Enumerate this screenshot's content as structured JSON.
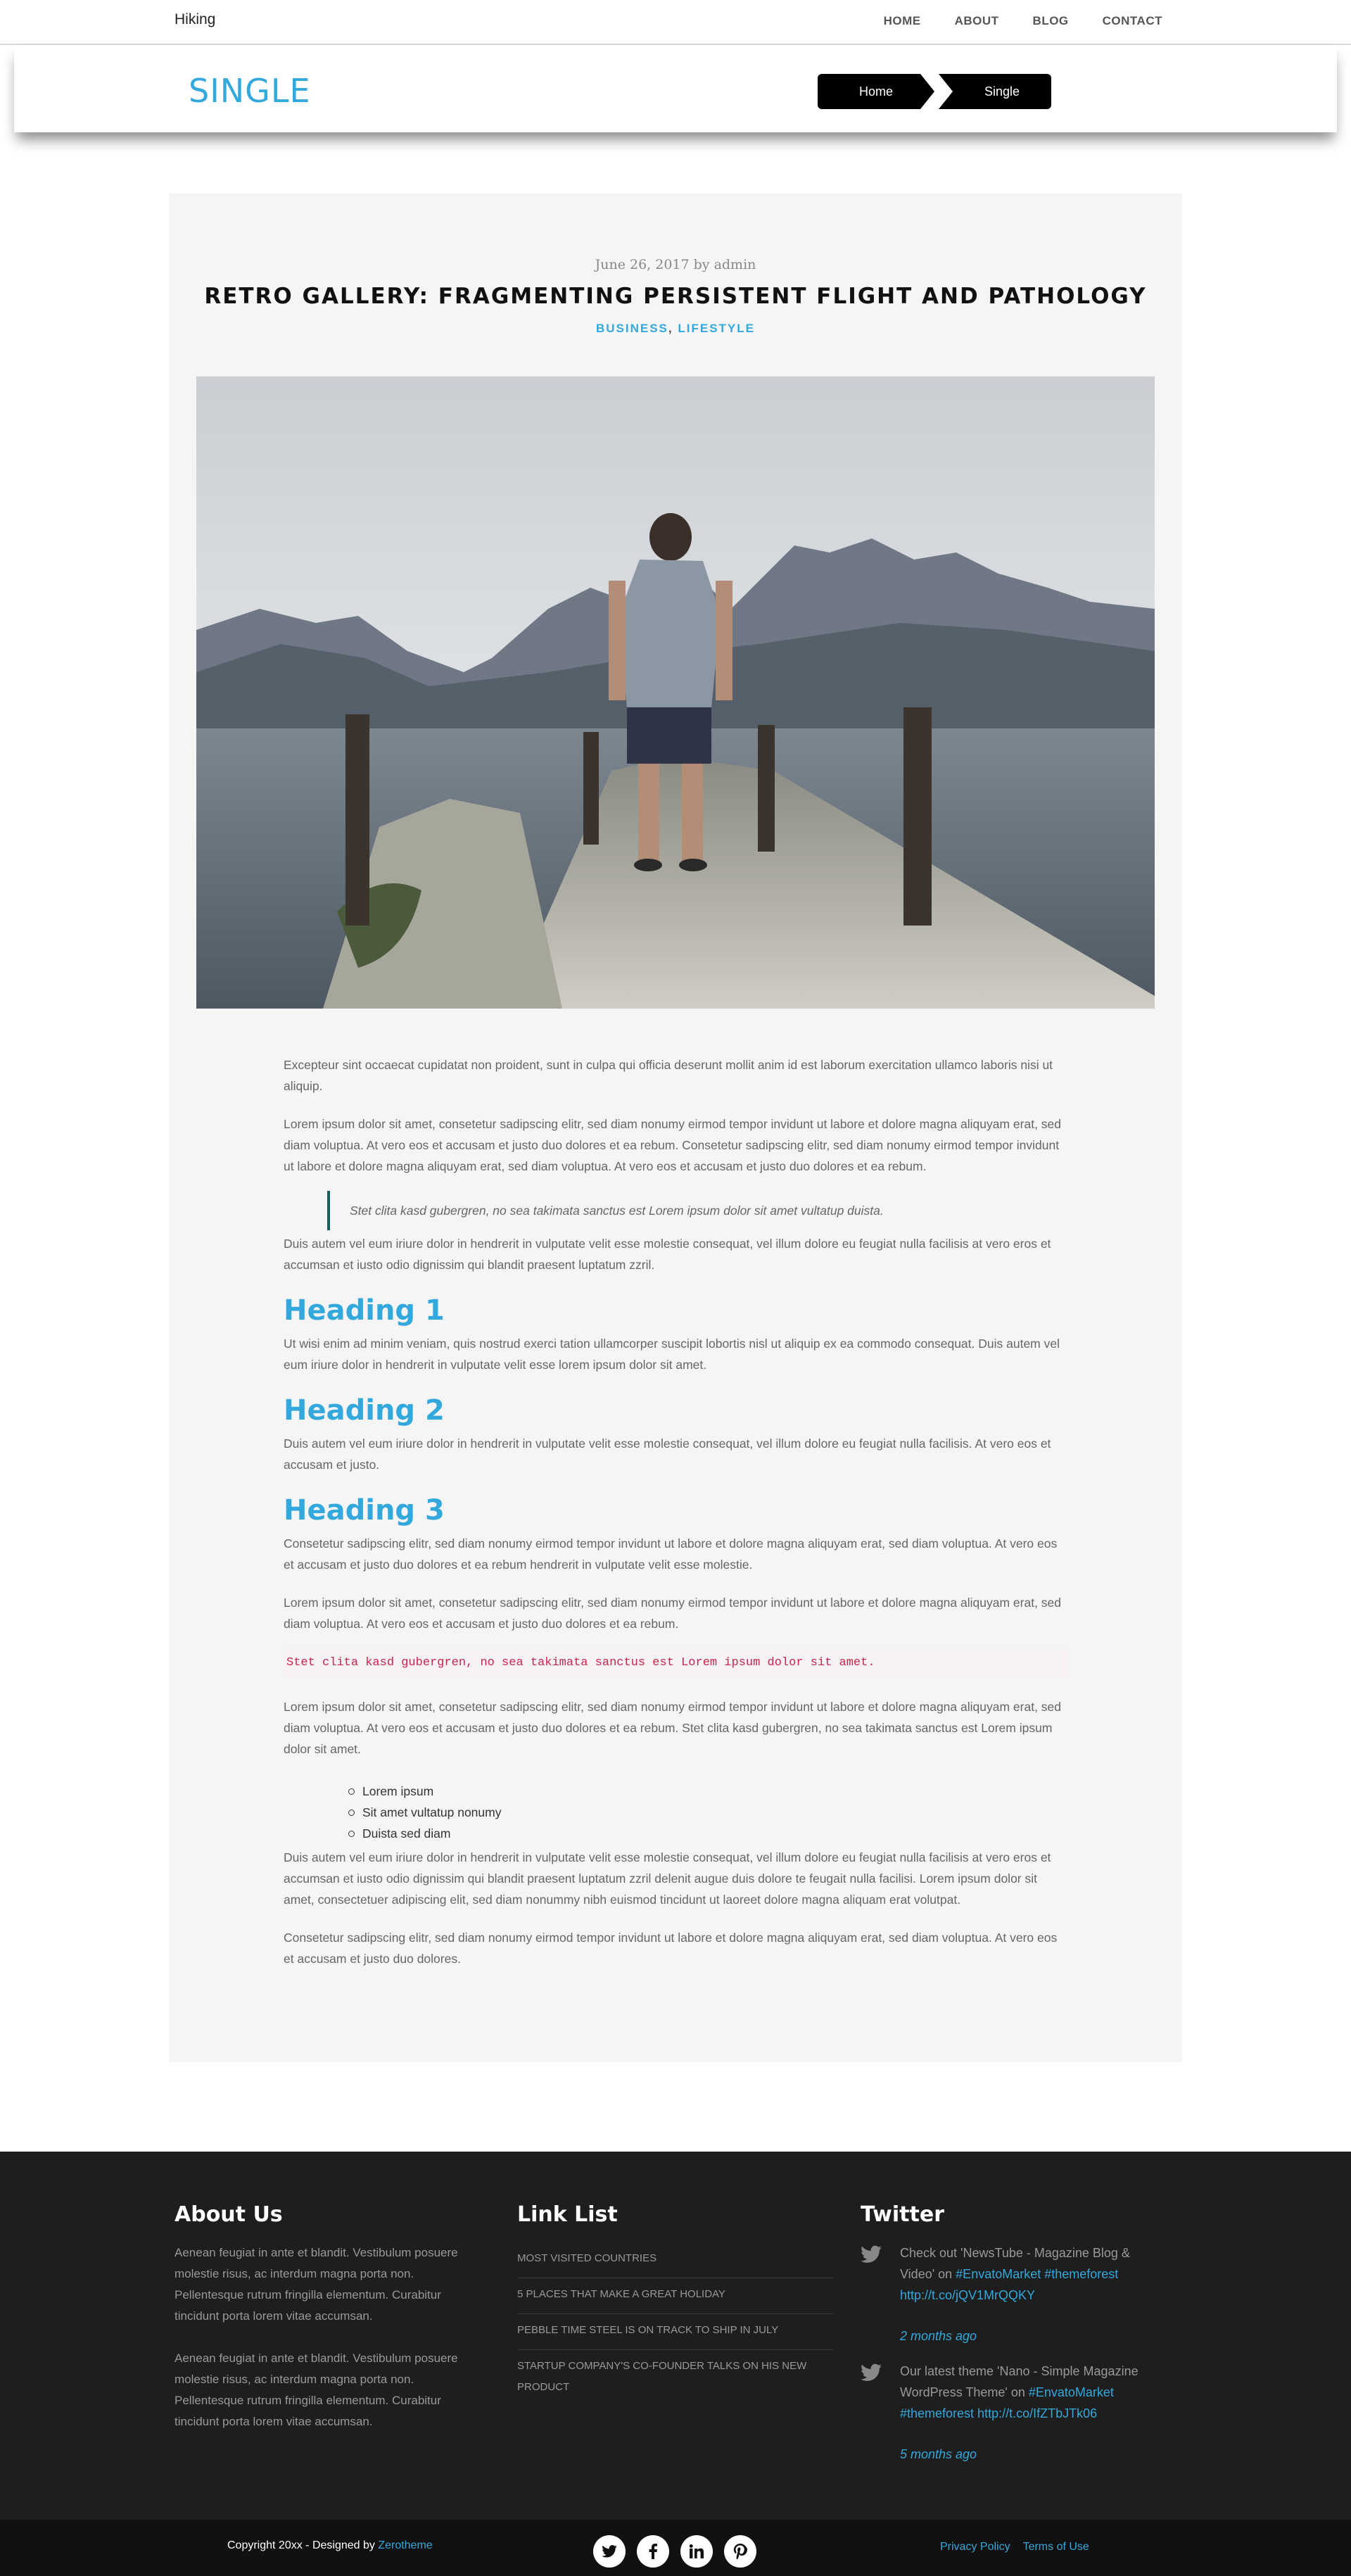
{
  "navbar": {
    "brand": "Hiking",
    "links": [
      "HOME",
      "ABOUT",
      "BLOG",
      "CONTACT"
    ]
  },
  "titlebar": {
    "title": "SINGLE",
    "breadcrumb": [
      "Home",
      "Single"
    ]
  },
  "post": {
    "meta": "June 26, 2017 by admin",
    "title": "RETRO GALLERY: FRAGMENTING PERSISTENT FLIGHT AND PATHOLOGY",
    "categories": [
      "BUSINESS",
      "LIFESTYLE"
    ],
    "category_separator": ",",
    "p1": "Excepteur sint occaecat cupidatat non proident, sunt in culpa qui officia deserunt mollit anim id est laborum exercitation ullamco laboris nisi ut aliquip.",
    "p2": "Lorem ipsum dolor sit amet, consetetur sadipscing elitr, sed diam nonumy eirmod tempor invidunt ut labore et dolore magna aliquyam erat, sed diam voluptua. At vero eos et accusam et justo duo dolores et ea rebum. Consetetur sadipscing elitr, sed diam nonumy eirmod tempor invidunt ut labore et dolore magna aliquyam erat, sed diam voluptua. At vero eos et accusam et justo duo dolores et ea rebum.",
    "quote": "Stet clita kasd gubergren, no sea takimata sanctus est Lorem ipsum dolor sit amet vultatup duista.",
    "p3": "Duis autem vel eum iriure dolor in hendrerit in vulputate velit esse molestie consequat, vel illum dolore eu feugiat nulla facilisis at vero eros et accumsan et iusto odio dignissim qui blandit praesent luptatum zzril.",
    "h1": "Heading 1",
    "p4": "Ut wisi enim ad minim veniam, quis nostrud exerci tation ullamcorper suscipit lobortis nisl ut aliquip ex ea commodo consequat. Duis autem vel eum iriure dolor in hendrerit in vulputate velit esse lorem ipsum dolor sit amet.",
    "h2": "Heading 2",
    "p5": "Duis autem vel eum iriure dolor in hendrerit in vulputate velit esse molestie consequat, vel illum dolore eu feugiat nulla facilisis. At vero eos et accusam et justo.",
    "h3": "Heading 3",
    "p6": "Consetetur sadipscing elitr, sed diam nonumy eirmod tempor invidunt ut labore et dolore magna aliquyam erat, sed diam voluptua. At vero eos et accusam et justo duo dolores et ea rebum hendrerit in vulputate velit esse molestie.",
    "p7": "Lorem ipsum dolor sit amet, consetetur sadipscing elitr, sed diam nonumy eirmod tempor invidunt ut labore et dolore magna aliquyam erat, sed diam voluptua. At vero eos et accusam et justo duo dolores et ea rebum.",
    "code": "Stet clita kasd gubergren, no sea takimata sanctus est Lorem ipsum dolor sit amet.",
    "p8": "Lorem ipsum dolor sit amet, consetetur sadipscing elitr, sed diam nonumy eirmod tempor invidunt ut labore et dolore magna aliquyam erat, sed diam voluptua. At vero eos et accusam et justo duo dolores et ea rebum. Stet clita kasd gubergren, no sea takimata sanctus est Lorem ipsum dolor sit amet.",
    "list": [
      "Lorem ipsum",
      "Sit amet vultatup nonumy",
      "Duista sed diam"
    ],
    "p9": "Duis autem vel eum iriure dolor in hendrerit in vulputate velit esse molestie consequat, vel illum dolore eu feugiat nulla facilisis at vero eros et accumsan et iusto odio dignissim qui blandit praesent luptatum zzril delenit augue duis dolore te feugait nulla facilisi. Lorem ipsum dolor sit amet, consectetuer adipiscing elit, sed diam nonummy nibh euismod tincidunt ut laoreet dolore magna aliquam erat volutpat.",
    "p10": "Consetetur sadipscing elitr, sed diam nonumy eirmod tempor invidunt ut labore et dolore magna aliquyam erat, sed diam voluptua. At vero eos et accusam et justo duo dolores."
  },
  "footer": {
    "about": {
      "heading": "About Us",
      "paragraphs": [
        "Aenean feugiat in ante et blandit. Vestibulum posuere molestie risus, ac interdum magna porta non. Pellentesque rutrum fringilla elementum. Curabitur tincidunt porta lorem vitae accumsan.",
        "Aenean feugiat in ante et blandit. Vestibulum posuere molestie risus, ac interdum magna porta non. Pellentesque rutrum fringilla elementum. Curabitur tincidunt porta lorem vitae accumsan."
      ]
    },
    "links": {
      "heading": "Link List",
      "items": [
        "MOST VISITED COUNTRIES",
        "5 PLACES THAT MAKE A GREAT HOLIDAY",
        "PEBBLE TIME STEEL IS ON TRACK TO SHIP IN JULY",
        "STARTUP COMPANY'S CO-FOUNDER TALKS ON HIS NEW PRODUCT"
      ]
    },
    "twitter": {
      "heading": "Twitter",
      "tweets": [
        {
          "text": "Check out 'NewsTube - Magazine Blog & Video' on ",
          "links": "#EnvatoMarket #themeforest http://t.co/jQV1MrQQKY",
          "ago": "2 months ago"
        },
        {
          "text": "Our latest theme 'Nano - Simple Magazine WordPress Theme' on ",
          "links": "#EnvatoMarket #themeforest http://t.co/IfZTbJTk06",
          "ago": "5 months ago"
        }
      ]
    },
    "copyright": "Copyright 20xx - Designed by ",
    "copyright_link": "Zerotheme",
    "social_icons": [
      "twitter-icon",
      "facebook-icon",
      "linkedin-icon",
      "pinterest-icon"
    ],
    "legal": [
      "Privacy Policy",
      "Terms of Use"
    ]
  },
  "colors": {
    "accent": "#33a8dc",
    "footer_bg": "#1e1e1e",
    "bottombar_bg": "#111111",
    "card_bg": "#f5f5f5",
    "code": "#c7254e"
  }
}
